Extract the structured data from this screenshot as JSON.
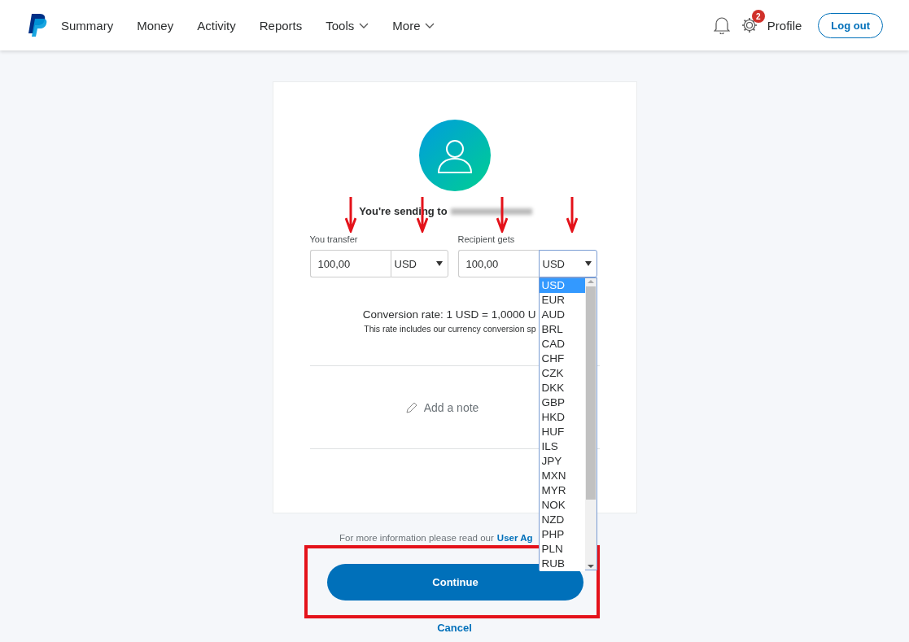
{
  "nav": {
    "items": [
      {
        "label": "Summary",
        "dropdown": false
      },
      {
        "label": "Money",
        "dropdown": false
      },
      {
        "label": "Activity",
        "dropdown": false
      },
      {
        "label": "Reports",
        "dropdown": false
      },
      {
        "label": "Tools",
        "dropdown": true
      },
      {
        "label": "More",
        "dropdown": true
      }
    ],
    "notification_count": "2",
    "profile": "Profile",
    "logout": "Log out"
  },
  "send": {
    "recipient_prefix": "You're sending to",
    "fields": [
      {
        "label": "You transfer",
        "amount": "100,00",
        "currency": "USD",
        "open": false
      },
      {
        "label": "Recipient gets",
        "amount": "100,00",
        "currency": "USD",
        "open": true
      }
    ],
    "currency_options": [
      {
        "label": "USD",
        "selected": true
      },
      {
        "label": "EUR",
        "selected": false
      },
      {
        "label": "AUD",
        "selected": false
      },
      {
        "label": "BRL",
        "selected": false
      },
      {
        "label": "CAD",
        "selected": false
      },
      {
        "label": "CHF",
        "selected": false
      },
      {
        "label": "CZK",
        "selected": false
      },
      {
        "label": "DKK",
        "selected": false
      },
      {
        "label": "GBP",
        "selected": false
      },
      {
        "label": "HKD",
        "selected": false
      },
      {
        "label": "HUF",
        "selected": false
      },
      {
        "label": "ILS",
        "selected": false
      },
      {
        "label": "JPY",
        "selected": false
      },
      {
        "label": "MXN",
        "selected": false
      },
      {
        "label": "MYR",
        "selected": false
      },
      {
        "label": "NOK",
        "selected": false
      },
      {
        "label": "NZD",
        "selected": false
      },
      {
        "label": "PHP",
        "selected": false
      },
      {
        "label": "PLN",
        "selected": false
      },
      {
        "label": "RUB",
        "selected": false
      }
    ],
    "conversion_rate": "Conversion rate: 1 USD = 1,0000 U",
    "conversion_note": "This rate includes our currency conversion sp",
    "add_note": "Add a note"
  },
  "footer": {
    "text": "For more information please read our",
    "link": "User Ag"
  },
  "continue": "Continue",
  "cancel": "Cancel"
}
